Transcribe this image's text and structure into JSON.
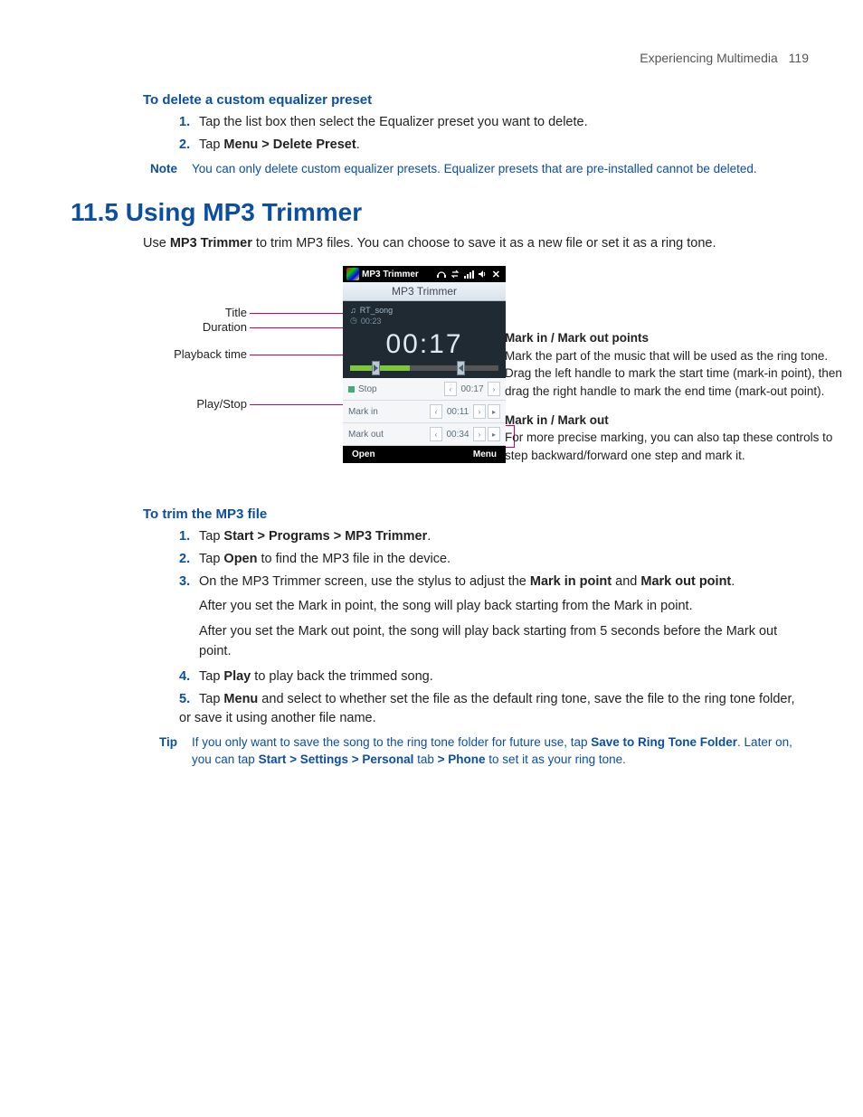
{
  "runhead": {
    "chapter": "Experiencing Multimedia",
    "page": "119"
  },
  "sec1": {
    "heading": "To delete a custom equalizer preset",
    "step1_num": "1.",
    "step1": "Tap the list box then select the Equalizer preset you want to delete.",
    "step2_num": "2.",
    "step2_pre": "Tap ",
    "step2_bold": "Menu > Delete Preset",
    "step2_post": "."
  },
  "note1": {
    "label": "Note",
    "text": "You can only delete custom equalizer presets. Equalizer presets that are pre-installed cannot be deleted."
  },
  "sec2": {
    "heading": "11.5  Using MP3 Trimmer"
  },
  "intro": {
    "pre": "Use ",
    "b": "MP3 Trimmer",
    "post": " to trim MP3 files. You can choose to save it as a new file or set it as a ring tone."
  },
  "labels": {
    "title": "Title",
    "duration": "Duration",
    "playback": "Playback time",
    "playstop": "Play/Stop"
  },
  "phone": {
    "topbar_title": "MP3 Trimmer",
    "screen_title": "MP3 Trimmer",
    "song": "RT_song",
    "dur": "00:23",
    "time": "00:17",
    "row_stop": "Stop",
    "row_stop_val": "00:17",
    "row_markin": "Mark in",
    "row_markin_val": "00:11",
    "row_markout": "Mark out",
    "row_markout_val": "00:34",
    "btn_open": "Open",
    "btn_menu": "Menu"
  },
  "annotR": {
    "h1": "Mark in / Mark out points",
    "p1": "Mark the part of the music that will be used as the ring tone. Drag the left handle to mark the start time (mark-in point), then drag the right handle to mark the end time (mark-out point).",
    "h2": "Mark in / Mark out",
    "p2": "For more precise marking, you can also tap these controls to step backward/forward one step and mark it."
  },
  "sec3": {
    "heading": "To trim the MP3 file",
    "s1_num": "1.",
    "s1_pre": "Tap ",
    "s1_b": "Start > Programs > MP3 Trimmer",
    "s1_post": ".",
    "s2_num": "2.",
    "s2_pre": "Tap ",
    "s2_b": "Open",
    "s2_post": " to find the MP3 file in the device.",
    "s3_num": "3.",
    "s3_pre": "On the MP3 Trimmer screen, use the stylus to adjust the ",
    "s3_b1": "Mark in point",
    "s3_mid": " and ",
    "s3_b2": "Mark out point",
    "s3_post": ".",
    "s3_p1": "After you set the Mark in point, the song will play back starting from the Mark in point.",
    "s3_p2": "After you set the Mark out point, the song will play back starting from 5 seconds before the Mark out point.",
    "s4_num": "4.",
    "s4_pre": "Tap ",
    "s4_b": "Play",
    "s4_post": " to play back the trimmed song.",
    "s5_num": "5.",
    "s5_pre": "Tap ",
    "s5_b": "Menu",
    "s5_post": " and select to whether set the file as the default ring tone, save the file to the ring tone folder, or save it using another file name."
  },
  "tip": {
    "label": "Tip",
    "t1": "If you only want to save the song to the ring tone folder for future use, tap ",
    "b1": "Save to Ring Tone Folder",
    "t2": ". Later on, you can tap ",
    "b2": "Start > Settings > Personal",
    "t3": " tab ",
    "b3": "> Phone",
    "t4": " to set it as your ring tone."
  }
}
